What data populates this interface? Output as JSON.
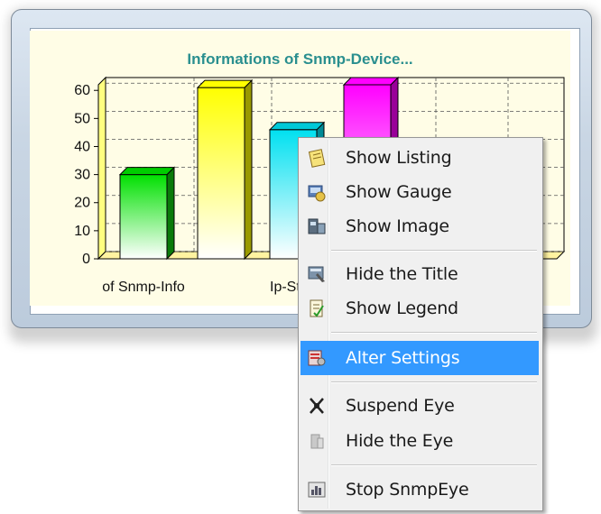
{
  "chart": {
    "title": "Informations of Snmp-Device...",
    "visible_x_labels": [
      "of Snmp-Info",
      "Ip-Sta"
    ]
  },
  "chart_data": {
    "type": "bar",
    "title": "Informations of Snmp-Device...",
    "ylim": [
      0,
      62
    ],
    "yticks": [
      0,
      10,
      20,
      30,
      40,
      50,
      60
    ],
    "grid": true,
    "series": [
      {
        "color": "#00cc00",
        "value": 30
      },
      {
        "color": "#ffff00",
        "value": 61
      },
      {
        "color": "#00c8d8",
        "value": 46
      },
      {
        "color": "#ff00ff",
        "value": 62
      }
    ],
    "categories": [
      "of Snmp-Info",
      "",
      "Ip-Sta",
      ""
    ]
  },
  "menu": {
    "items": [
      {
        "label": "Show Listing",
        "icon": "notepad-icon"
      },
      {
        "label": "Show Gauge",
        "icon": "gauge-icon"
      },
      {
        "label": "Show Image",
        "icon": "image-icon"
      },
      {
        "label": "Hide the Title",
        "icon": "title-icon"
      },
      {
        "label": "Show Legend",
        "icon": "legend-icon"
      },
      {
        "label": "Alter Settings",
        "icon": "settings-icon"
      },
      {
        "label": "Suspend Eye",
        "icon": "eye-icon"
      },
      {
        "label": "Hide the Eye",
        "icon": "hide-eye-icon"
      },
      {
        "label": "Stop SnmpEye",
        "icon": "stop-icon"
      }
    ],
    "highlighted": "Alter Settings"
  }
}
